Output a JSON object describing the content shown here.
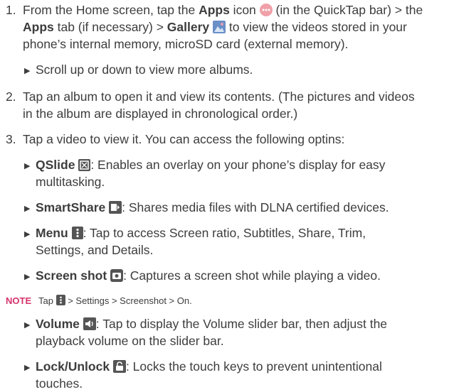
{
  "steps": [
    {
      "number": "1.",
      "p1": "From the Home screen, tap the ",
      "apps_bold": "Apps",
      "p2": " icon ",
      "p3": " (in the QuickTap bar) > the",
      "apps_tab_bold": "Apps",
      "p4": " tab (if necessary) > ",
      "gallery_bold": "Gallery",
      "p5": " to view the videos stored in your",
      "p6": "phone’s internal memory, microSD card (external memory)."
    },
    {
      "number": "2.",
      "line1": "Tap an album to open it and view its contents. (The pictures and videos",
      "line2": "in the album are displayed in chronological order.)"
    },
    {
      "number": "3.",
      "line1": "Tap a video to view it. You can access the following optins:"
    }
  ],
  "scroll_bullet": "Scroll up or down to view more albums.",
  "options": {
    "qslide_label": "QSlide",
    "qslide_text1": ": Enables an overlay on your phone’s display for easy",
    "qslide_text2": "multitasking.",
    "smartshare_label": "SmartShare",
    "smartshare_text": ": Shares media files with DLNA certified devices.",
    "menu_label": "Menu",
    "menu_text1": ": Tap to access ",
    "menu_items1": "Screen ratio, Subtitles, Share, Trim,",
    "menu_items2": "Settings,",
    "menu_and": " and ",
    "menu_details": "Details",
    "menu_end": ".",
    "screenshot_label": "Screen shot",
    "screenshot_text": ": Captures a screen shot while playing a video.",
    "volume_label": "Volume",
    "volume_text1": ": Tap to display the Volume slider bar, then adjust the",
    "volume_text2": "playback volume on the slider bar.",
    "lock_label": "Lock/Unlock",
    "lock_text1": ": Locks the touch keys to prevent unintentional",
    "lock_text2": "touches."
  },
  "note": {
    "label": "NOTE",
    "tap": "Tap ",
    "path": " > Settings > Screenshot > On."
  }
}
